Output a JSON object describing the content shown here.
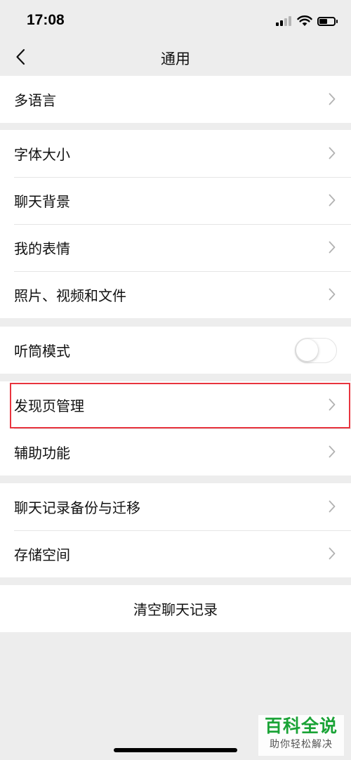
{
  "status_bar": {
    "time": "17:08",
    "battery_level": 0.55,
    "signal_bars_active": 2,
    "signal_bars_total": 4
  },
  "nav": {
    "title": "通用",
    "back_icon": "chevron-left-icon"
  },
  "groups": [
    {
      "items": [
        {
          "label": "多语言",
          "control": "chevron"
        }
      ]
    },
    {
      "items": [
        {
          "label": "字体大小",
          "control": "chevron"
        },
        {
          "label": "聊天背景",
          "control": "chevron"
        },
        {
          "label": "我的表情",
          "control": "chevron"
        },
        {
          "label": "照片、视频和文件",
          "control": "chevron"
        }
      ]
    },
    {
      "items": [
        {
          "label": "听筒模式",
          "control": "toggle",
          "toggle_on": false
        }
      ]
    },
    {
      "items": [
        {
          "label": "发现页管理",
          "control": "chevron",
          "highlighted": true
        },
        {
          "label": "辅助功能",
          "control": "chevron"
        }
      ]
    },
    {
      "items": [
        {
          "label": "聊天记录备份与迁移",
          "control": "chevron"
        },
        {
          "label": "存储空间",
          "control": "chevron"
        }
      ]
    }
  ],
  "clear_chat": {
    "label": "清空聊天记录"
  },
  "watermark": {
    "title": "百科全说",
    "subtitle": "助你轻松解决"
  },
  "colors": {
    "background": "#ededed",
    "cell": "#ffffff",
    "highlight": "#e8343e",
    "watermark_green": "#1aa336"
  }
}
